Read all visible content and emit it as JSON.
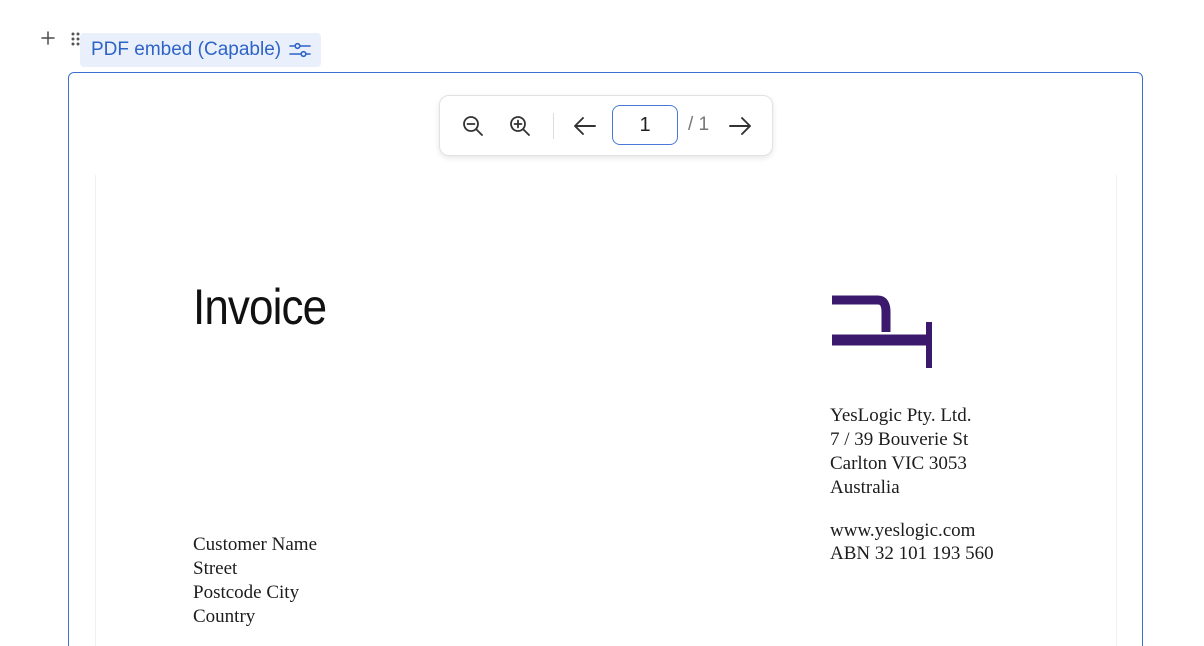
{
  "block": {
    "add_icon": "plus-icon",
    "drag_icon": "drag-handle-icon",
    "label": "PDF embed (Capable)",
    "settings_icon": "sliders-icon"
  },
  "toolbar": {
    "zoom_out_icon": "zoom-out-icon",
    "zoom_in_icon": "zoom-in-icon",
    "prev_icon": "arrow-left-icon",
    "next_icon": "arrow-right-icon",
    "current_page": "1",
    "total_pages": "/ 1"
  },
  "document": {
    "title": "Invoice",
    "company": {
      "lines": [
        "YesLogic Pty. Ltd.",
        "7 / 39 Bouverie St",
        "Carlton VIC 3053",
        "Australia"
      ]
    },
    "web": {
      "lines": [
        "www.yeslogic.com",
        "ABN 32 101 193 560"
      ]
    },
    "customer": {
      "lines": [
        "Customer Name",
        "Street",
        "Postcode City",
        "Country"
      ]
    },
    "logo_color": "#3b1a6e"
  },
  "colors": {
    "accent": "#3d6fd1",
    "label_bg": "#e9f0fb",
    "label_text": "#2e63c8"
  }
}
